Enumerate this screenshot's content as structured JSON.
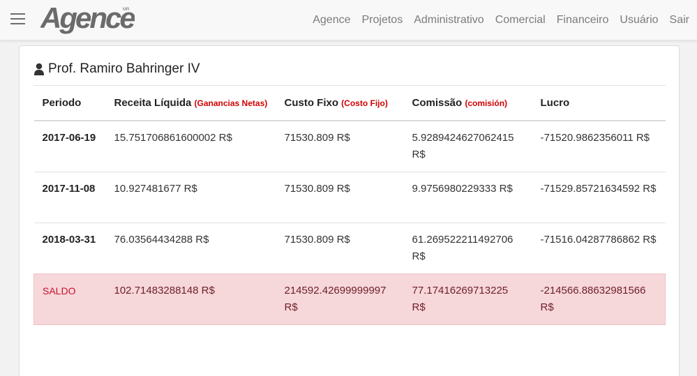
{
  "navbar": {
    "logo_text": "Agence",
    "logo_mark": "MR",
    "links": [
      "Agence",
      "Projetos",
      "Administrativo",
      "Comercial",
      "Financeiro",
      "Usuário",
      "Sair"
    ]
  },
  "report": {
    "consultant_name": "Prof. Ramiro Bahringer IV",
    "headers": {
      "periodo": "Periodo",
      "receita": "Receita Líquida",
      "receita_es": "(Ganancias Netas)",
      "custo": "Custo Fixo",
      "custo_es": "(Costo Fijo)",
      "comissao": "Comissão",
      "comissao_es": "(comisión)",
      "lucro": "Lucro"
    },
    "rows": [
      {
        "periodo": "2017-06-19",
        "receita": "15.751706861600002 R$",
        "custo": "71530.809 R$",
        "comissao": "5.9289424627062415 R$",
        "lucro": "-71520.9862356011 R$"
      },
      {
        "periodo": "2017-11-08",
        "receita": "10.927481677 R$",
        "custo": "71530.809 R$",
        "comissao": "9.9756980229333 R$",
        "lucro": "-71529.85721634592 R$"
      },
      {
        "periodo": "2018-03-31",
        "receita": "76.03564434288 R$",
        "custo": "71530.809 R$",
        "comissao": "61.269522211492706 R$",
        "lucro": "-71516.04287786862 R$"
      }
    ],
    "saldo": {
      "label": "SALDO",
      "receita": "102.71483288148 R$",
      "custo": "214592.42699999997 R$",
      "comissao": "77.17416269713225 R$",
      "lucro": "-214566.88632981566 R$"
    }
  },
  "colors": {
    "accent_red": "#d00000",
    "saldo_bg": "#f6d7da",
    "nav_text": "#7b7b7b"
  }
}
